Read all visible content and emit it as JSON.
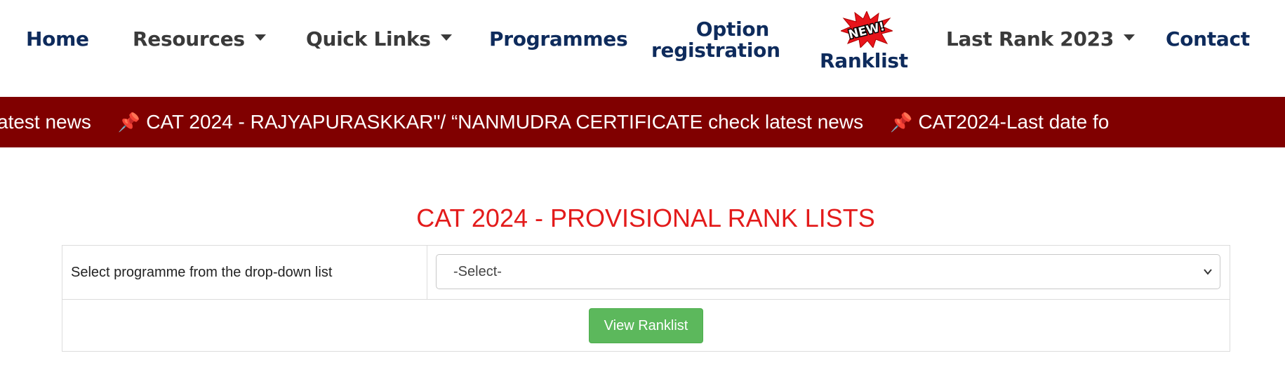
{
  "nav": {
    "home": "Home",
    "resources": "Resources",
    "quick_links": "Quick Links",
    "programmes": "Programmes",
    "option_registration_line1": "Option",
    "option_registration_line2": "registration",
    "ranklist": "Ranklist",
    "new_badge": "NEW!",
    "last_rank": "Last Rank 2023",
    "contact": "Contact"
  },
  "ticker": {
    "items": [
      "atest news",
      "CAT 2024 - RAJYAPURASKKAR\"/ “NANMUDRA CERTIFICATE check latest news",
      "CAT2024-Last date fo"
    ],
    "pin_icon": "pushpin-icon"
  },
  "page": {
    "title": "CAT 2024 - PROVISIONAL RANK LISTS"
  },
  "form": {
    "label": "Select programme from the drop-down list",
    "select_value": "-Select-",
    "button_label": "View Ranklist"
  },
  "colors": {
    "nav_text": "#0e2b5c",
    "ticker_bg": "#800000",
    "title": "#e31b1b",
    "button": "#5cb85c"
  }
}
